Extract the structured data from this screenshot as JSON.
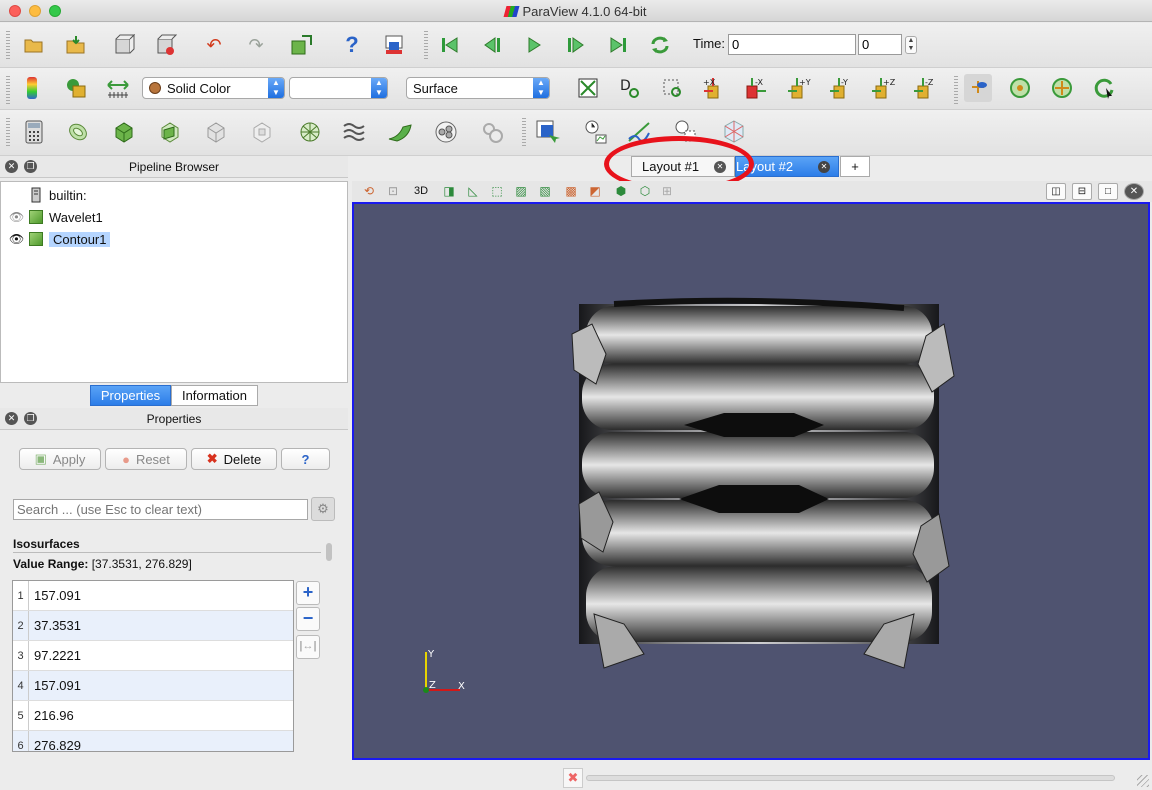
{
  "window": {
    "title": "ParaView 4.1.0 64-bit"
  },
  "toolbar_main": {
    "time_label": "Time:",
    "time_value": "0",
    "time_step": "0"
  },
  "toolbar_display": {
    "color_by": "Solid Color",
    "color_component": "",
    "representation": "Surface",
    "camera_labels": [
      "+X",
      "-X",
      "+Y",
      "-Y",
      "+Z",
      "-Z"
    ]
  },
  "pipeline_browser": {
    "title": "Pipeline Browser",
    "items": [
      {
        "label": "builtin:",
        "type": "server"
      },
      {
        "label": "Wavelet1",
        "type": "source"
      },
      {
        "label": "Contour1",
        "type": "filter",
        "selected": true
      }
    ]
  },
  "panel_tabs": {
    "properties": "Properties",
    "information": "Information"
  },
  "properties": {
    "title": "Properties",
    "apply": "Apply",
    "reset": "Reset",
    "delete": "Delete",
    "help": "?",
    "search_placeholder": "Search ... (use Esc to clear text)",
    "section": "Isosurfaces",
    "value_range_label": "Value Range:",
    "value_range": "[37.3531, 276.829]",
    "iso_values": [
      {
        "index": "1",
        "value": "157.091"
      },
      {
        "index": "2",
        "value": "37.3531"
      },
      {
        "index": "3",
        "value": "97.2221"
      },
      {
        "index": "4",
        "value": "157.091"
      },
      {
        "index": "5",
        "value": "216.96"
      },
      {
        "index": "6",
        "value": "276.829"
      }
    ]
  },
  "layout_tabs": {
    "tab1": "Layout #1",
    "tab2": "Layout #2",
    "add": "+"
  },
  "view_toolbar": {
    "mode_3d": "3D"
  },
  "axes": {
    "x": "X",
    "y": "Y",
    "z": "Z"
  },
  "colors": {
    "accent": "#2c7de8",
    "render_bg": "#4f5370",
    "highlight_circle": "#e8121b",
    "active_view_border": "#1a1aef"
  }
}
